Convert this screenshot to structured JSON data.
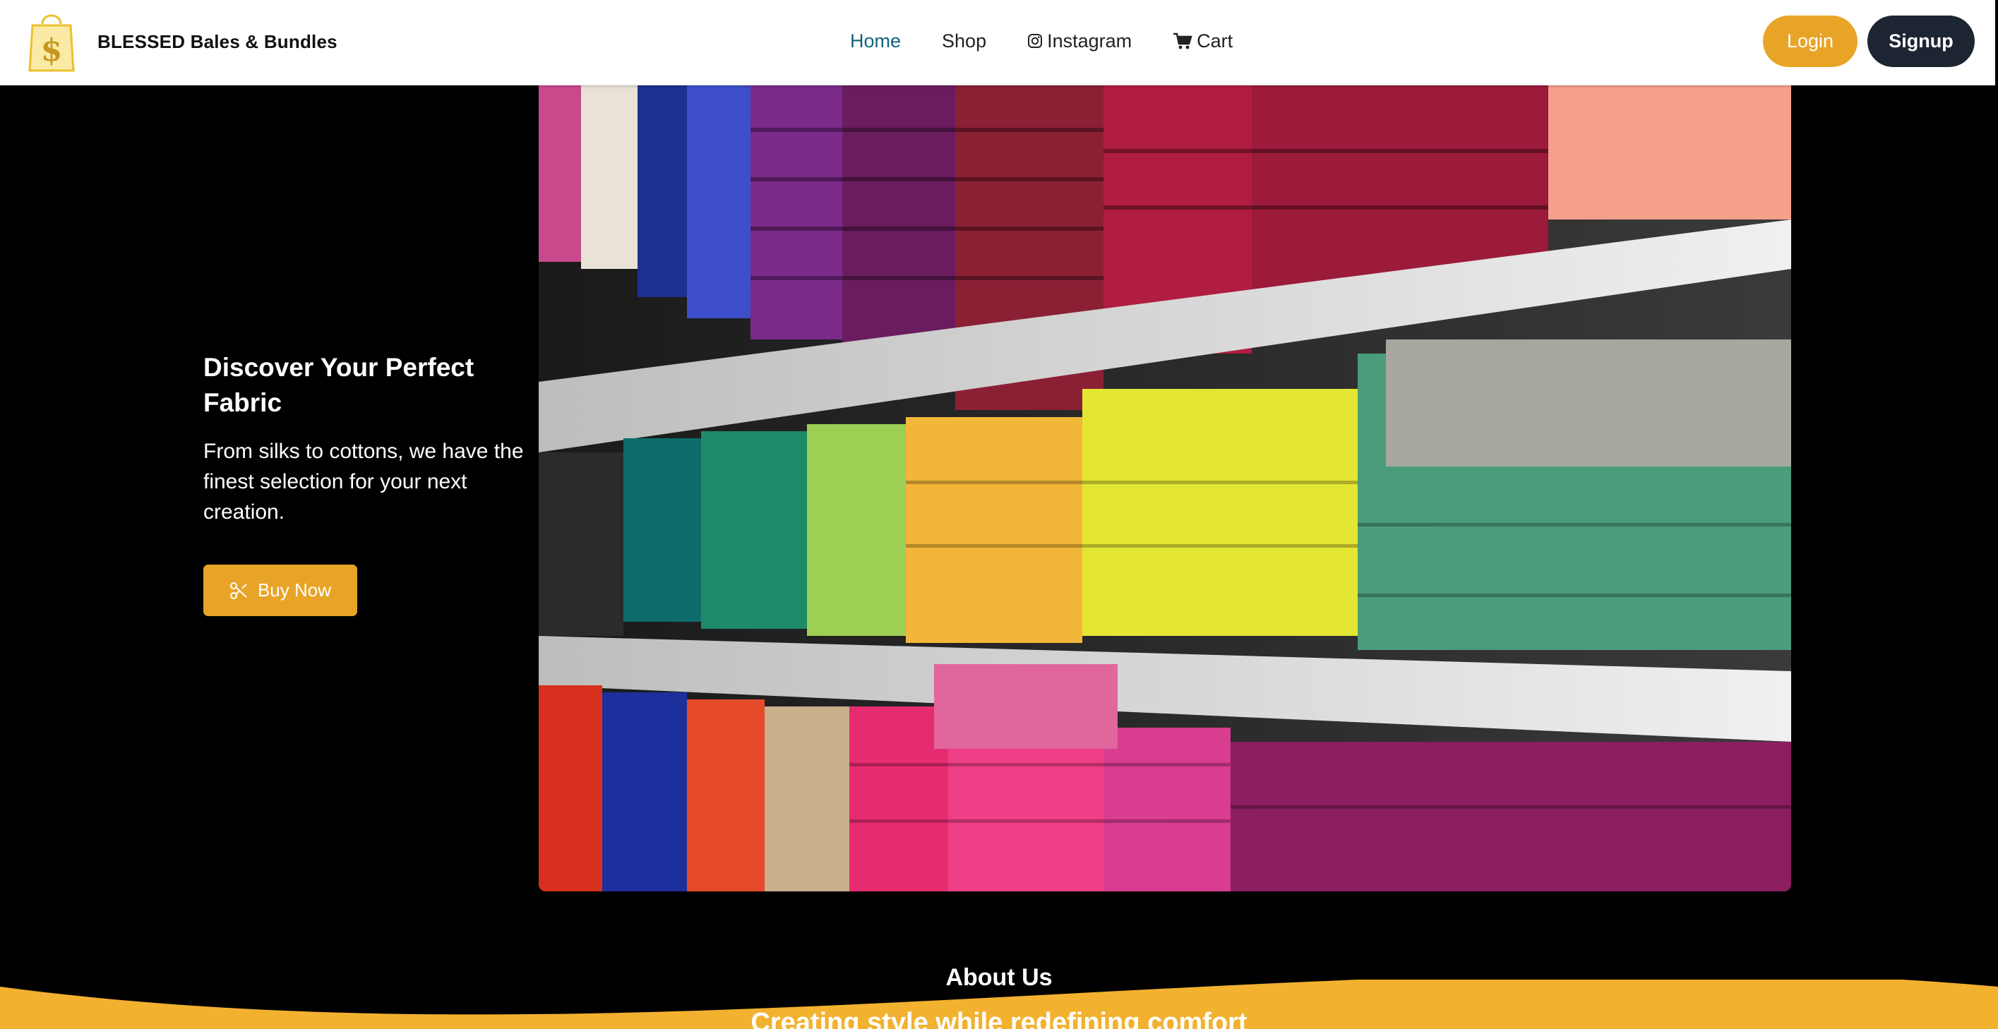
{
  "brand": {
    "name": "BLESSED Bales & Bundles",
    "logo_icon": "shopping-bag-dollar-logo"
  },
  "nav": {
    "links": [
      {
        "label": "Home",
        "active": true
      },
      {
        "label": "Shop"
      },
      {
        "label": "Instagram",
        "icon": "instagram-icon"
      },
      {
        "label": "Cart",
        "icon": "cart-icon"
      }
    ],
    "login_label": "Login",
    "signup_label": "Signup"
  },
  "hero": {
    "title": "Discover Your Perfect Fabric",
    "subtitle": "From silks to cottons, we have the finest selection for your next creation.",
    "cta_label": "Buy Now",
    "cta_icon": "scissors-icon",
    "image": "shelves-of-colorful-folded-fabric-bolts"
  },
  "about": {
    "title": "About Us",
    "subtitle": "Creating style while redefining comfort"
  },
  "colors": {
    "accent": "#e8a427",
    "dark_button": "#1e2532",
    "active_link": "#11647e",
    "background": "#000000"
  }
}
